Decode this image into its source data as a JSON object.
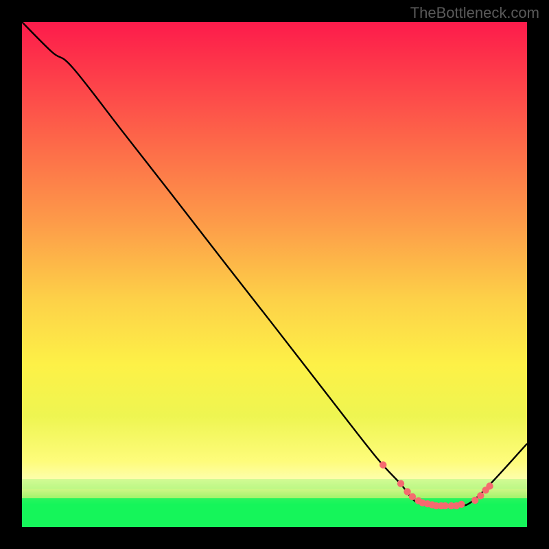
{
  "attribution": "TheBottleneck.com",
  "colors": {
    "bg": "#000000",
    "attribution": "#616161",
    "curve": "#000000",
    "marker": "#f56a6f",
    "optimal_band": "#13f45a",
    "optimal_edge_outer": "#80f36a",
    "optimal_edge_inner": "#b5f26b"
  },
  "gradient_stops": [
    {
      "o": 0,
      "c": "#fd1b4b"
    },
    {
      "o": 0.1,
      "c": "#fd3b4a"
    },
    {
      "o": 0.25,
      "c": "#fd6c49"
    },
    {
      "o": 0.4,
      "c": "#fd9c49"
    },
    {
      "o": 0.55,
      "c": "#fdd148"
    },
    {
      "o": 0.68,
      "c": "#fdf147"
    },
    {
      "o": 0.78,
      "c": "#eef551"
    },
    {
      "o": 0.87,
      "c": "#fefc7b"
    },
    {
      "o": 0.905,
      "c": "#fdfeab"
    },
    {
      "o": 0.925,
      "c": "#dbfa93"
    },
    {
      "o": 0.945,
      "c": "#8ff469"
    },
    {
      "o": 0.955,
      "c": "#21f45b"
    },
    {
      "o": 1.0,
      "c": "#21f45b"
    }
  ],
  "chart_data": {
    "type": "line",
    "title": "",
    "xlabel": "",
    "ylabel": "",
    "xlim": [
      0,
      100
    ],
    "ylim": [
      0,
      100
    ],
    "series": [
      {
        "name": "bottleneck-curve",
        "x": [
          0,
          6,
          10,
          20,
          30,
          40,
          50,
          60,
          70,
          75,
          78,
          82,
          86,
          90,
          100
        ],
        "y": [
          100,
          94,
          91,
          78.2,
          65.4,
          52.5,
          39.7,
          26.8,
          14.0,
          8.5,
          5.0,
          4.2,
          4.2,
          5.8,
          16.5
        ]
      }
    ],
    "markers": {
      "name": "highlighted-points",
      "x": [
        71.5,
        75,
        76.3,
        77.3,
        78.5,
        79.3,
        80.3,
        81.2,
        82,
        83,
        83.8,
        85,
        86,
        87,
        89.7,
        90.8,
        91.8,
        92.6
      ],
      "y": [
        12.3,
        8.6,
        7.0,
        6.0,
        5.2,
        4.8,
        4.6,
        4.4,
        4.2,
        4.2,
        4.2,
        4.2,
        4.2,
        4.5,
        5.3,
        6.2,
        7.3,
        8.1
      ]
    }
  }
}
